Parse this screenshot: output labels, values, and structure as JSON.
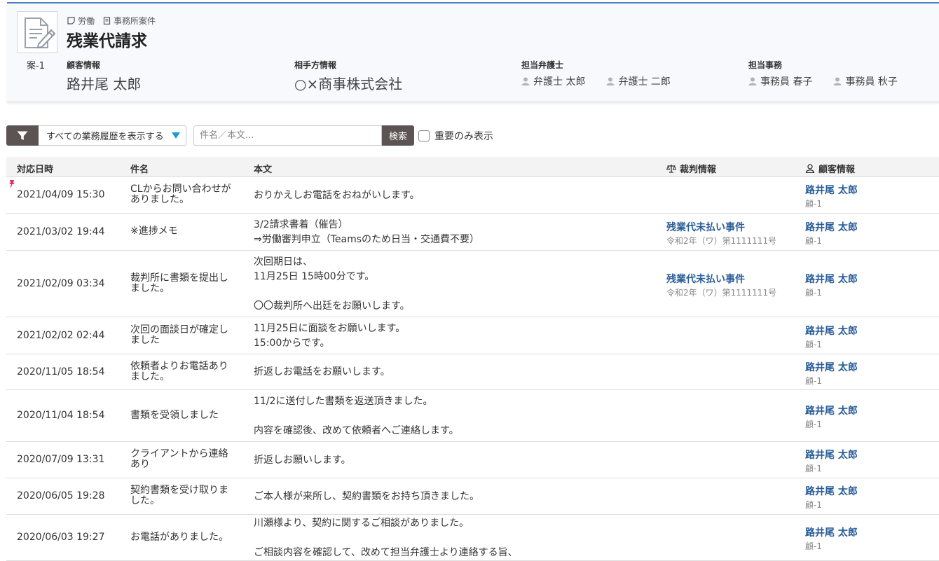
{
  "header": {
    "case_id": "案-1",
    "tags": [
      {
        "label": "労働",
        "icon": "note-icon"
      },
      {
        "label": "事務所案件",
        "icon": "building-icon"
      }
    ],
    "title": "残業代請求",
    "client": {
      "label": "顧客情報",
      "name": "路井尾 太郎"
    },
    "opponent": {
      "label": "相手方情報",
      "name": "○×商事株式会社"
    },
    "lawyers": {
      "label": "担当弁護士",
      "people": [
        "弁護士 太郎",
        "弁護士 二郎"
      ]
    },
    "staff": {
      "label": "担当事務",
      "people": [
        "事務員 春子",
        "事務員 秋子"
      ]
    }
  },
  "toolbar": {
    "filter_icon": "funnel-icon",
    "filter_select": "すべての業務履歴を表示する",
    "search_placeholder": "件名／本文...",
    "search_button": "検索",
    "important_only": "重要のみ表示"
  },
  "table": {
    "columns": {
      "date": "対応日時",
      "subject": "件名",
      "body": "本文",
      "court": "裁判情報",
      "client": "顧客情報"
    },
    "rows": [
      {
        "date": "2021/04/09 15:30",
        "subject": "CLからお問い合わせがありました。",
        "body": [
          "おりかえしお電話をおねがいします。"
        ],
        "court_title": "",
        "court_case": "",
        "client_name": "路井尾 太郎",
        "client_id": "顧-1",
        "pinned": true
      },
      {
        "date": "2021/03/02 19:44",
        "subject": "※進捗メモ",
        "body": [
          "3/2請求書着（催告）",
          "⇒労働審判申立（Teamsのため日当・交通費不要）"
        ],
        "court_title": "残業代未払い事件",
        "court_case": "令和2年（ワ）第1111111号",
        "client_name": "路井尾 太郎",
        "client_id": "顧-1",
        "pinned": false
      },
      {
        "date": "2021/02/09 03:34",
        "subject": "裁判所に書類を提出しました。",
        "body": [
          "次回期日は、",
          "11月25日 15時00分です。",
          "",
          "〇〇裁判所へ出廷をお願いします。"
        ],
        "court_title": "残業代未払い事件",
        "court_case": "令和2年（ワ）第1111111号",
        "client_name": "路井尾 太郎",
        "client_id": "顧-1",
        "pinned": false
      },
      {
        "date": "2021/02/02 02:44",
        "subject": "次回の面談日が確定しました",
        "body": [
          "11月25日に面談をお願いします。",
          "15:00からです。"
        ],
        "court_title": "",
        "court_case": "",
        "client_name": "路井尾 太郎",
        "client_id": "顧-1",
        "pinned": false
      },
      {
        "date": "2020/11/05 18:54",
        "subject": "依頼者よりお電話ありました。",
        "body": [
          "折返しお電話をお願いします。"
        ],
        "court_title": "",
        "court_case": "",
        "client_name": "路井尾 太郎",
        "client_id": "顧-1",
        "pinned": false
      },
      {
        "date": "2020/11/04 18:54",
        "subject": "書類を受領しました",
        "body": [
          "11/2に送付した書類を返送頂きました。",
          "",
          "内容を確認後、改めて依頼者へご連絡します。"
        ],
        "court_title": "",
        "court_case": "",
        "client_name": "路井尾 太郎",
        "client_id": "顧-1",
        "pinned": false
      },
      {
        "date": "2020/07/09 13:31",
        "subject": "クライアントから連絡あり",
        "body": [
          "折返しお願いします。"
        ],
        "court_title": "",
        "court_case": "",
        "client_name": "路井尾 太郎",
        "client_id": "顧-1",
        "pinned": false
      },
      {
        "date": "2020/06/05 19:28",
        "subject": "契約書類を受け取りました。",
        "body": [
          "ご本人様が来所し、契約書類をお持ち頂きました。"
        ],
        "court_title": "",
        "court_case": "",
        "client_name": "路井尾 太郎",
        "client_id": "顧-1",
        "pinned": false
      },
      {
        "date": "2020/06/03 19:27",
        "subject": "お電話がありました。",
        "body": [
          "川瀬様より、契約に関するご相談がありました。",
          "",
          "ご相談内容を確認して、改めて担当弁護士より連絡する旨、"
        ],
        "court_title": "",
        "court_case": "",
        "client_name": "路井尾 太郎",
        "client_id": "顧-1",
        "pinned": false
      }
    ]
  },
  "colors": {
    "accent_link": "#2a5d98",
    "dark_button": "#5c5453",
    "select_arrow": "#1a9bd7",
    "top_line": "#4a82c3"
  }
}
